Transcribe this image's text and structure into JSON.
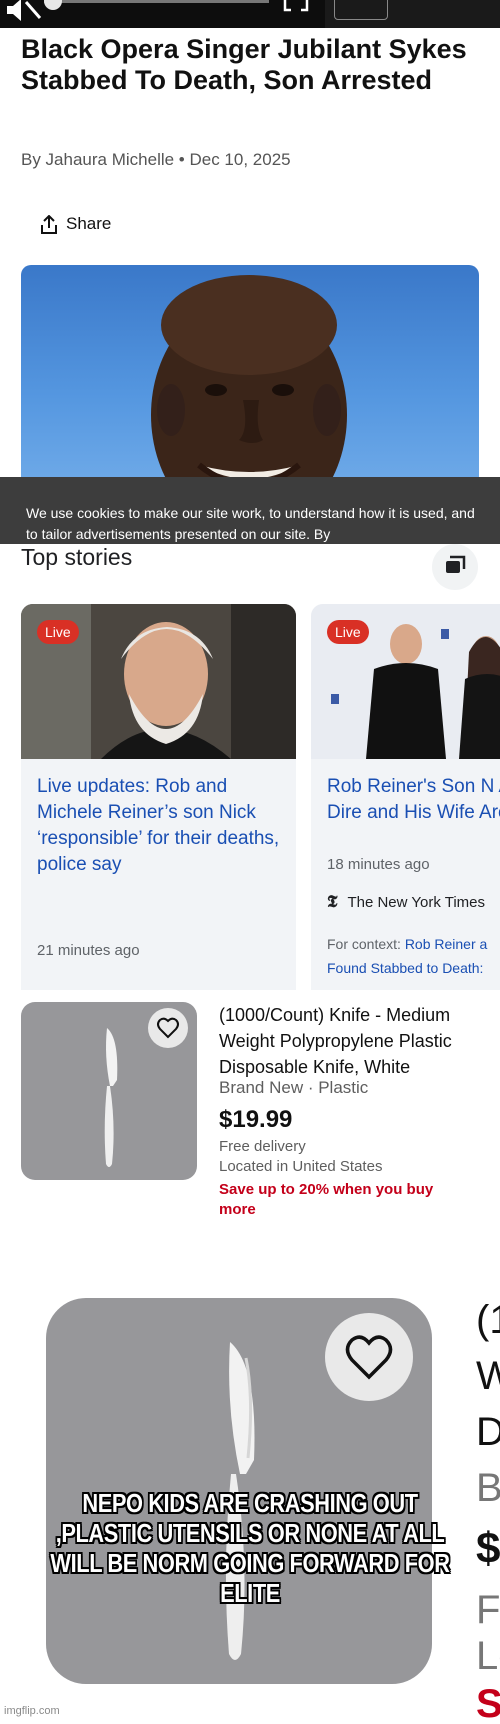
{
  "article": {
    "headline": "Black Opera Singer Jubilant Sykes Stabbed To Death, Son Arrested",
    "byline": "By Jahaura Michelle • Dec 10, 2025",
    "share_label": "Share",
    "cookie_text": "We use cookies to make our site work, to understand how it is used, and to tailor advertisements presented on our site. By"
  },
  "top_stories": {
    "title": "Top stories",
    "cards": [
      {
        "badge": "Live",
        "headline": "Live updates: Rob and Michele Reiner’s son Nick ‘responsible’ for their deaths, police say",
        "time": "21 minutes ago"
      },
      {
        "badge": "Live",
        "headline": "Rob Reiner's Son N Arrested After Dire and His Wife Are F",
        "time": "18 minutes ago",
        "source": "The New York Times",
        "context_label": "For context:",
        "context_link": "Rob Reiner a",
        "context_link2": "Found Stabbed to Death:"
      }
    ]
  },
  "listing": {
    "title": "(1000/Count) Knife - Medium Weight Polypropylene Plastic Disposable Knife, White",
    "condition": "Brand New · Plastic",
    "price": "$19.99",
    "delivery": "Free delivery",
    "location": "Located in United States",
    "promo": "Save up to 20% when you buy more"
  },
  "zoomed_listing": {
    "edge_chars": [
      "(1",
      "W",
      "D",
      "B",
      "$",
      "Fr",
      "Lo",
      "S"
    ]
  },
  "meme_caption": "NEPO KIDS ARE CRASHING OUT ,PLASTIC UTENSILS OR NONE AT ALL WILL BE NORM GOING FORWARD FOR ELITE",
  "watermark": "imgflip.com"
}
